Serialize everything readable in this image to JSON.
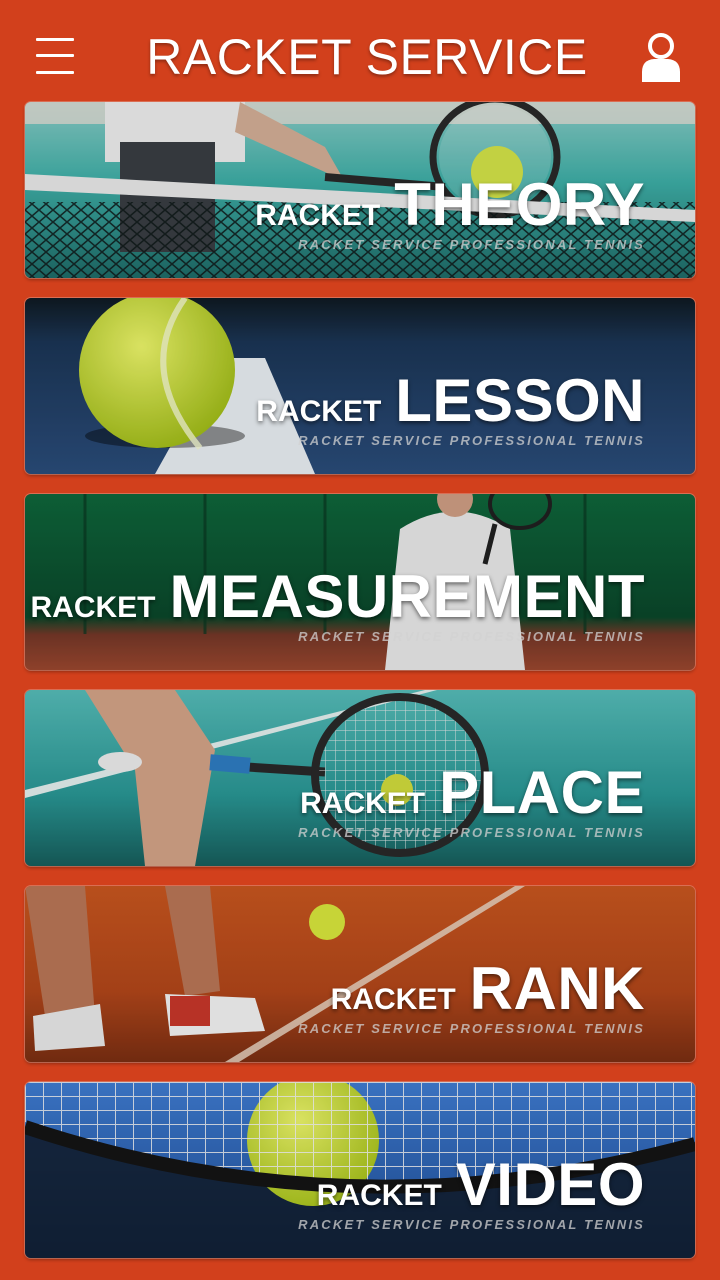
{
  "header": {
    "title": "RACKET SERVICE",
    "menu_icon": "hamburger-menu-icon",
    "user_icon": "user-profile-icon"
  },
  "cards": [
    {
      "small": "RACKET",
      "big": "THEORY",
      "subtitle": "RACKET SERVICE PROFESSIONAL TENNIS"
    },
    {
      "small": "RACKET",
      "big": "LESSON",
      "subtitle": "RACKET SERVICE PROFESSIONAL TENNIS"
    },
    {
      "small": "RACKET",
      "big": "MEASUREMENT",
      "subtitle": "RACKET SERVICE PROFESSIONAL TENNIS"
    },
    {
      "small": "RACKET",
      "big": "PLACE",
      "subtitle": "RACKET SERVICE PROFESSIONAL TENNIS"
    },
    {
      "small": "RACKET",
      "big": "RANK",
      "subtitle": "RACKET SERVICE PROFESSIONAL TENNIS"
    },
    {
      "small": "RACKET",
      "big": "VIDEO",
      "subtitle": "RACKET SERVICE PROFESSIONAL TENNIS"
    }
  ],
  "colors": {
    "background": "#d2401c",
    "text": "#ffffff"
  }
}
